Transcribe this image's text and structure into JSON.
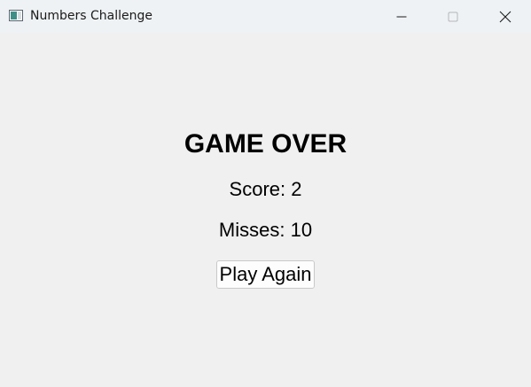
{
  "window": {
    "title": "Numbers Challenge",
    "app_icon": "app-window-icon",
    "controls": {
      "minimize_icon": "minimize-icon",
      "maximize_icon": "maximize-icon",
      "close_icon": "close-icon"
    }
  },
  "game_over": {
    "heading": "GAME OVER",
    "score_text": "Score: 2",
    "misses_text": "Misses: 10",
    "play_again_label": "Play Again"
  },
  "colors": {
    "background": "#f0f0f0",
    "titlebar": "#eff2f4",
    "text": "#000000"
  }
}
